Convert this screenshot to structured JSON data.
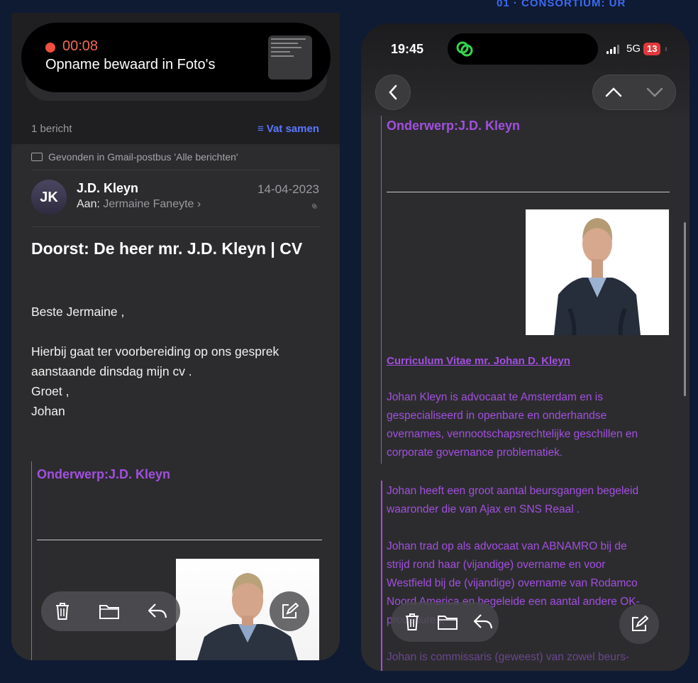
{
  "colors": {
    "quote_purple": "#a24fe0",
    "accent_blue": "#5a78ff",
    "record_red": "#f26a52",
    "battery_red": "#e0393c"
  },
  "left": {
    "recording": {
      "time": "00:08",
      "message": "Opname bewaard in Foto's"
    },
    "message_count": "1 bericht",
    "summarize_label": "Vat samen",
    "found_in": "Gevonden in Gmail-postbus 'Alle berichten'",
    "avatar_initials": "JK",
    "sender": "J.D. Kleyn",
    "to_label": "Aan:",
    "to_name": "Jermaine Faneyte",
    "date": "14-04-2023",
    "subject": "Doorst: De heer mr. J.D. Kleyn | CV",
    "greeting": "Beste Jermaine ,",
    "body_lines": [
      "Hierbij gaat ter voorbereiding op ons gesprek",
      "aanstaande dinsdag mijn cv .",
      "Groet ,",
      "Johan"
    ],
    "quote_subject": "Onderwerp:J.D. Kleyn"
  },
  "right": {
    "status": {
      "time": "19:45",
      "network": "5G",
      "battery": "13"
    },
    "quote_subject": "Onderwerp:J.D. Kleyn",
    "cv_title": "Curriculum Vitae mr. Johan D. Kleyn",
    "paragraphs": [
      [
        "Johan Kleyn is advocaat te Amsterdam en is",
        "gespecialiseerd in openbare en onderhandse",
        "overnames, vennootschapsrechtelijke geschillen en",
        "corporate governance problematiek."
      ],
      [
        "Johan heeft een groot aantal beursgangen begeleid",
        "waaronder die van Ajax en SNS Reaal ."
      ],
      [
        "Johan trad op als advocaat van ABNAMRO bij de",
        "strijd rond haar (vijandige) overname en voor",
        "Westfield bij de (vijandige)  overname van Rodamco",
        "Noord America en begeleide een aantal andere OK-",
        "procedures."
      ],
      [
        "Johan is commissaris (geweest) van zowel beurs-"
      ]
    ]
  }
}
